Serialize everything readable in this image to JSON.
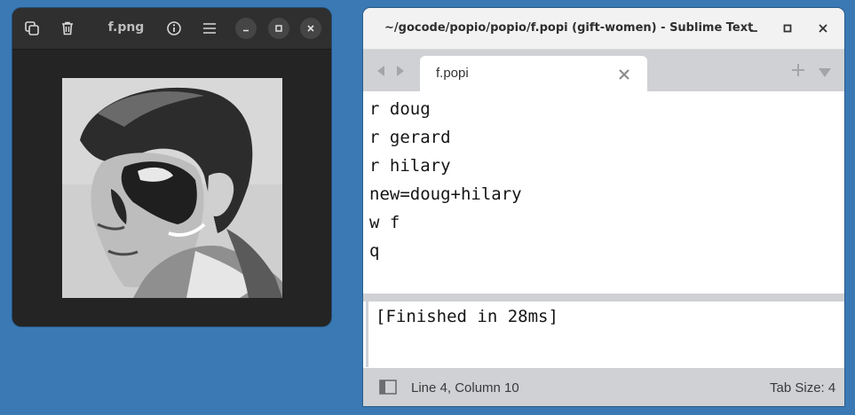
{
  "viewer": {
    "title": "f.png",
    "icons": [
      "copy-icon",
      "trash-icon",
      "info-icon",
      "menu-icon",
      "minimize-icon",
      "maximize-icon",
      "close-icon"
    ]
  },
  "editor": {
    "window_title": "~/gocode/popio/popio/f.popi (gift-women) - Sublime Text",
    "tab_label": "f.popi",
    "lines": [
      "r doug",
      "r gerard",
      "r hilary",
      "new=doug+hilary",
      "w f",
      "q"
    ],
    "output": "[Finished in 28ms]",
    "status_position": "Line 4, Column 10",
    "status_tab_size": "Tab Size: 4"
  },
  "colors": {
    "desktop": "#3a79b4",
    "viewer_bg": "#242424",
    "sublime_chrome": "#cfd1d5"
  }
}
